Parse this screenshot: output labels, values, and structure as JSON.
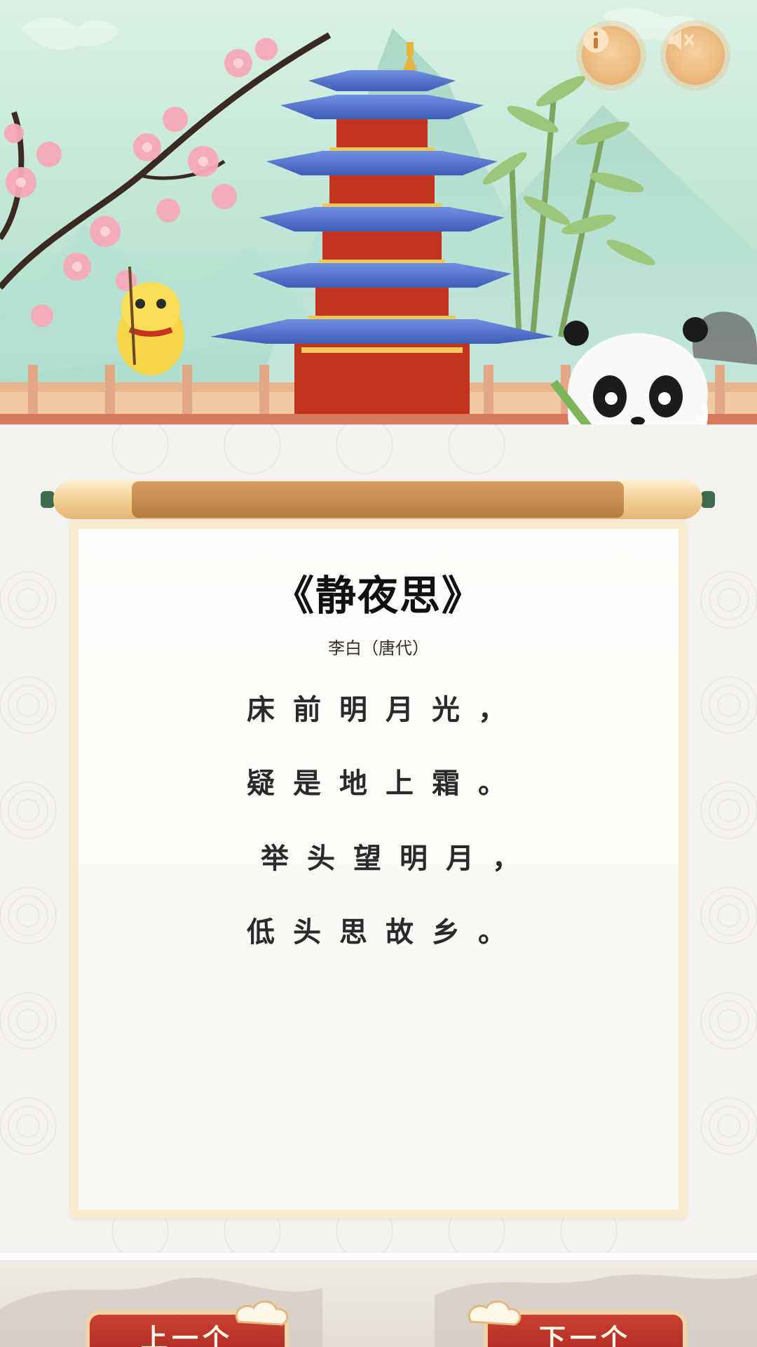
{
  "app": {
    "accent": "#a9271d",
    "paper_border": "#f9e9cd",
    "sky": "#bfe7d7"
  },
  "header_icons": {
    "info": "info-icon",
    "mute": "speaker-mute-icon"
  },
  "poem": {
    "title": "《静夜思》",
    "author": "李白（唐代）",
    "lines": [
      "床前明月光，",
      "疑是地上霜。",
      "举头望明月，",
      "低头思故乡。"
    ]
  },
  "navigation": {
    "prev_label": "上一个",
    "next_label": "下一个"
  }
}
